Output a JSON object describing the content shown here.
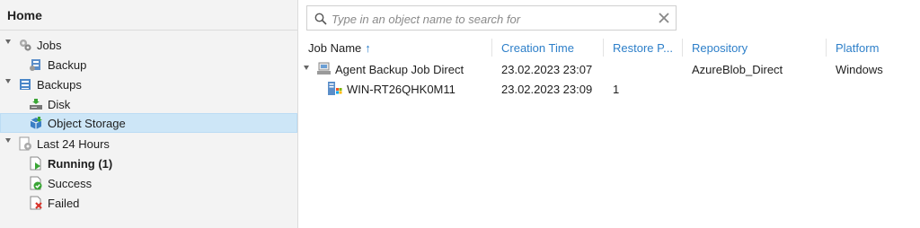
{
  "sidebar": {
    "title": "Home",
    "items": [
      {
        "label": "Jobs",
        "icon": "jobs-gear-icon",
        "level": 0,
        "expanded": true
      },
      {
        "label": "Backup",
        "icon": "backup-job-icon",
        "level": 1
      },
      {
        "label": "Backups",
        "icon": "backups-icon",
        "level": 0,
        "expanded": true
      },
      {
        "label": "Disk",
        "icon": "disk-icon",
        "level": 1
      },
      {
        "label": "Object Storage",
        "icon": "object-storage-icon",
        "level": 1,
        "selected": true
      },
      {
        "label": "Last 24 Hours",
        "icon": "last-24-hours-icon",
        "level": 0,
        "expanded": true
      },
      {
        "label": "Running (1)",
        "icon": "running-icon",
        "level": 1,
        "bold": true
      },
      {
        "label": "Success",
        "icon": "success-icon",
        "level": 1
      },
      {
        "label": "Failed",
        "icon": "failed-icon",
        "level": 1
      }
    ]
  },
  "search": {
    "placeholder": "Type in an object name to search for"
  },
  "table": {
    "columns": [
      "Job Name",
      "Creation Time",
      "Restore P...",
      "Repository",
      "Platform"
    ],
    "sort_icon": "sort-arrow-up-icon",
    "rows": [
      {
        "name": "Agent Backup Job Direct",
        "creation_time": "23.02.2023 23:07",
        "restore_points": "",
        "repository": "AzureBlob_Direct",
        "platform": "Windows",
        "icon": "agent-job-icon",
        "expanded": true
      },
      {
        "name": "WIN-RT26QHK0M11",
        "creation_time": "23.02.2023 23:09",
        "restore_points": "1",
        "repository": "",
        "platform": "",
        "icon": "windows-server-icon"
      }
    ]
  },
  "colors": {
    "accent": "#2d7fc9",
    "selection": "#cde6f7",
    "sidebar_bg": "#f3f3f3"
  }
}
